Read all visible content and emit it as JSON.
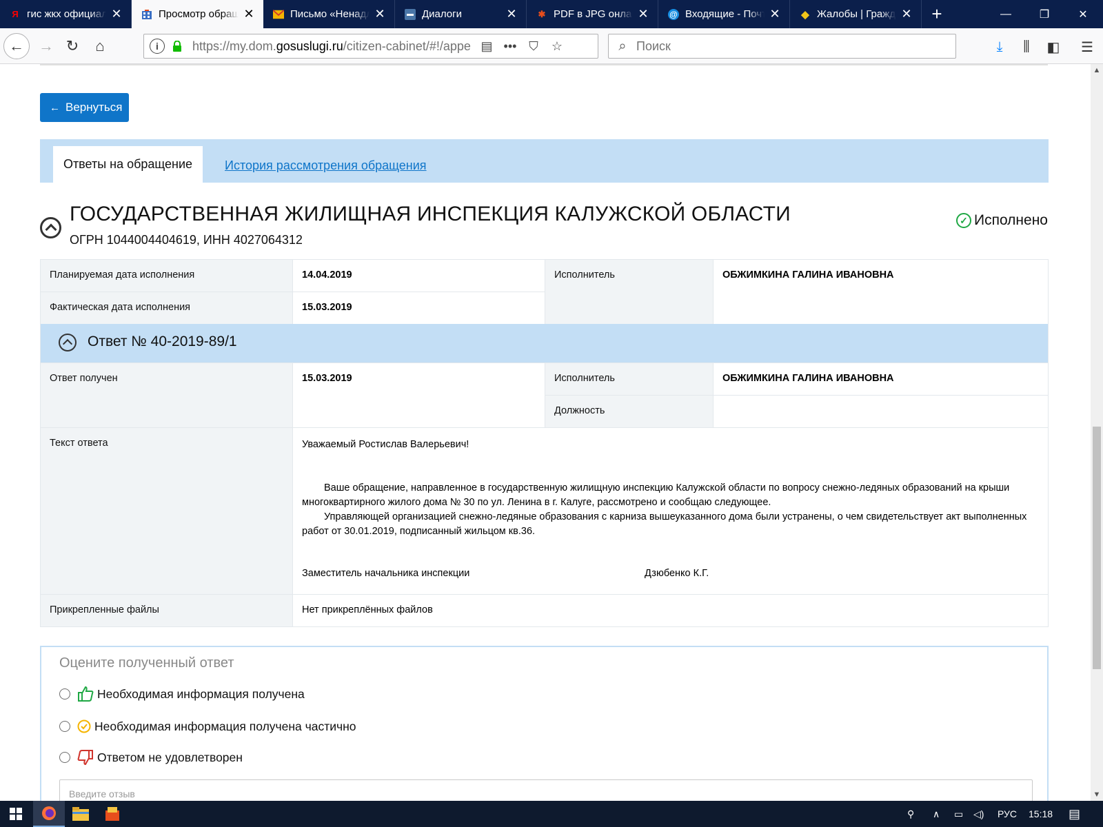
{
  "browser": {
    "tabs": [
      {
        "title": "гис жкх официал",
        "icon": "yandex-icon",
        "icon_color": "#ff0000",
        "active": false
      },
      {
        "title": "Просмотр обращ",
        "icon": "gosuslugi-icon",
        "icon_color": "#3a6fc4",
        "active": true
      },
      {
        "title": "Письмо «Ненадл",
        "icon": "mail-envelope-icon",
        "icon_color": "#f5b400",
        "active": false
      },
      {
        "title": "Диалоги",
        "icon": "chat-icon",
        "icon_color": "#4a76a8",
        "active": false
      },
      {
        "title": "PDF в JPG онлайн",
        "icon": "pdf-convert-icon",
        "icon_color": "#e84e1c",
        "active": false
      },
      {
        "title": "Входящие - Почт",
        "icon": "mailru-icon",
        "icon_color": "#168de2",
        "active": false
      },
      {
        "title": "Жалобы | Гражда",
        "icon": "diamond-icon",
        "icon_color": "#f0c419",
        "active": false
      }
    ],
    "url_prefix": "https://my.dom.",
    "url_domain": "gosuslugi.ru",
    "url_path": "/citizen-cabinet/#!/appe",
    "search_placeholder": "Поиск"
  },
  "page": {
    "back_button": "Вернуться",
    "tab_answers": "Ответы на обращение",
    "tab_history": "История рассмотрения обращения",
    "org_name": "ГОСУДАРСТВЕННАЯ ЖИЛИЩНАЯ ИНСПЕКЦИЯ КАЛУЖСКОЙ ОБЛАСТИ",
    "org_ids": "ОГРН 1044004404619, ИНН 4027064312",
    "status": "Исполнено",
    "summary": {
      "planned_label": "Планируемая дата исполнения",
      "planned_value": "14.04.2019",
      "actual_label": "Фактическая дата исполнения",
      "actual_value": "15.03.2019",
      "executor_label": "Исполнитель",
      "executor_value": "ОБЖИМКИНА ГАЛИНА ИВАНОВНА"
    },
    "answer": {
      "title": "Ответ № 40-2019-89/1",
      "received_label": "Ответ получен",
      "received_value": "15.03.2019",
      "executor_label": "Исполнитель",
      "executor_value": "ОБЖИМКИНА ГАЛИНА ИВАНОВНА",
      "position_label": "Должность",
      "position_value": "",
      "text_label": "Текст ответа",
      "greeting": "Уважаемый Ростислав Валерьевич!",
      "paragraph1": "Ваше обращение, направленное в государственную жилищную инспекцию Калужской области по вопросу снежно-ледяных образований на крыши многоквартирного жилого дома № 30 по ул. Ленина  в г. Калуге, рассмотрено и сообщаю следующее.",
      "paragraph2": "Управляющей организацией снежно-ледяные образования с карниза вышеуказанного дома были устранены, о чем свидетельствует акт выполненных работ от 30.01.2019, подписанный жильцом кв.36.",
      "signer_position": "Заместитель начальника инспекции",
      "signer_name": "Дзюбенко К.Г.",
      "files_label": "Прикрепленные файлы",
      "files_value": "Нет прикреплённых файлов"
    },
    "rating": {
      "title": "Оцените полученный ответ",
      "options": [
        {
          "label": "Необходимая информация получена",
          "icon": "thumbs-up-icon",
          "color": "#1fa844"
        },
        {
          "label": "Необходимая информация получена частично",
          "icon": "check-circle-icon",
          "color": "#f5b400"
        },
        {
          "label": "Ответом не удовлетворен",
          "icon": "thumbs-down-icon",
          "color": "#d0342c"
        }
      ],
      "review_placeholder": "Введите отзыв"
    }
  },
  "taskbar": {
    "language": "РУС",
    "time": "15:18"
  },
  "colors": {
    "accent": "#0f75c9",
    "band": "#c3def5",
    "success": "#1fa844"
  }
}
